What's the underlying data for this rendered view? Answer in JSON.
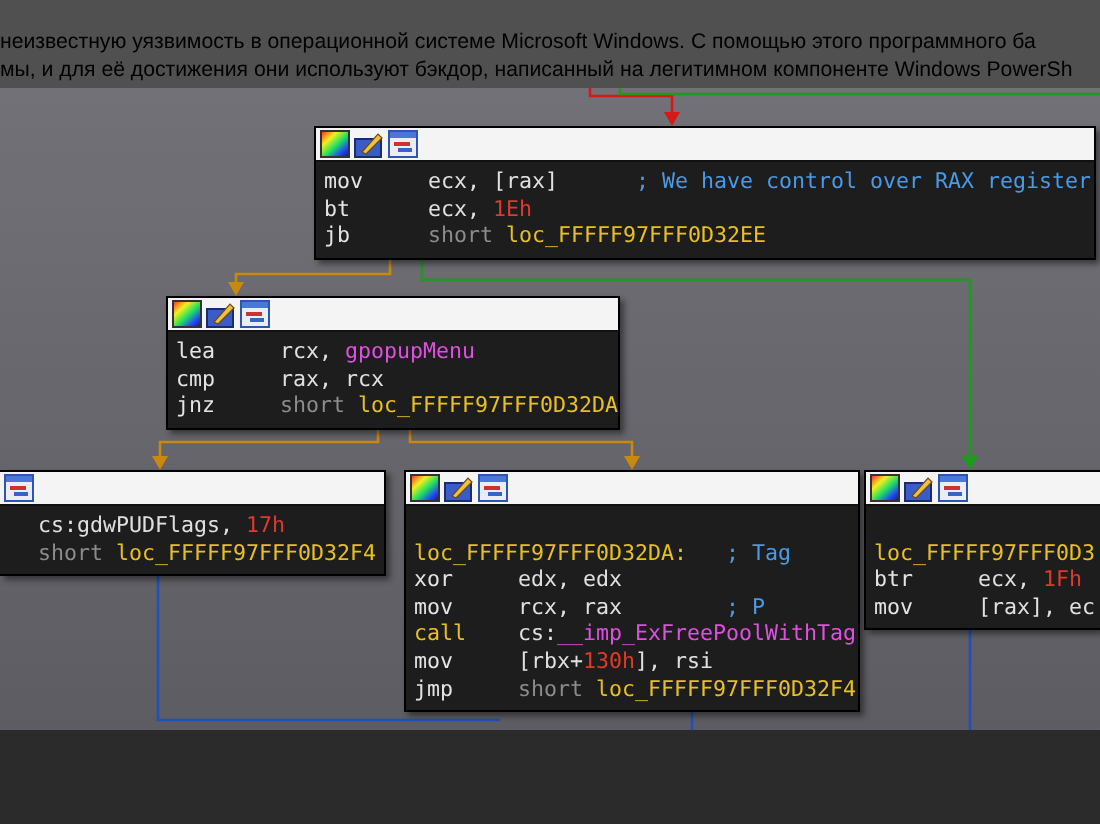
{
  "article_text": [
    "неизвестную уязвимость в операционной системе Microsoft Windows. С помощью этого программного ба",
    "мы, и для её достижения они используют бэкдор, написанный на легитимном компоненте Windows PowerSh"
  ],
  "graph": {
    "nodes": [
      {
        "lines": [
          {
            "kind": "instruction",
            "mnemonic": "mov",
            "operands": [
              {
                "text": "ecx, [rax]",
                "kind": "plain"
              }
            ],
            "comment": "; We have control over RAX register"
          },
          {
            "kind": "instruction",
            "mnemonic": "bt",
            "operands": [
              {
                "text": "ecx, ",
                "kind": "plain"
              },
              {
                "text": "1Eh",
                "kind": "number"
              }
            ]
          },
          {
            "kind": "instruction",
            "mnemonic": "jb",
            "operands": [
              {
                "text": "short ",
                "kind": "keyword"
              },
              {
                "text": "loc_FFFFF97FFF0D32EE",
                "kind": "location"
              }
            ]
          }
        ]
      },
      {
        "lines": [
          {
            "kind": "instruction",
            "mnemonic": "lea",
            "operands": [
              {
                "text": "rcx, ",
                "kind": "plain"
              },
              {
                "text": "gpopupMenu",
                "kind": "name"
              }
            ]
          },
          {
            "kind": "instruction",
            "mnemonic": "cmp",
            "operands": [
              {
                "text": "rax, rcx",
                "kind": "plain"
              }
            ]
          },
          {
            "kind": "instruction",
            "mnemonic": "jnz",
            "operands": [
              {
                "text": "short ",
                "kind": "keyword"
              },
              {
                "text": "loc_FFFFF97FFF0D32DA",
                "kind": "location"
              }
            ]
          }
        ]
      },
      {
        "lines": [
          {
            "kind": "instruction",
            "operands": [
              {
                "text": "cs:gdwPUDFlags, ",
                "kind": "plain"
              },
              {
                "text": "17h",
                "kind": "number"
              }
            ]
          },
          {
            "kind": "instruction",
            "operands": [
              {
                "text": "short ",
                "kind": "keyword"
              },
              {
                "text": "loc_FFFFF97FFF0D32F4",
                "kind": "location"
              }
            ]
          }
        ]
      },
      {
        "lines": [
          {
            "kind": "label",
            "gap_before": true,
            "label": "loc_FFFFF97FFF0D32DA:",
            "comment": "; Tag"
          },
          {
            "kind": "instruction",
            "mnemonic": "xor",
            "operands": [
              {
                "text": "edx, edx",
                "kind": "plain"
              }
            ]
          },
          {
            "kind": "instruction",
            "mnemonic": "mov",
            "operands": [
              {
                "text": "rcx, rax",
                "kind": "plain"
              }
            ],
            "comment": "; P"
          },
          {
            "kind": "call",
            "mnemonic": "call",
            "operands": [
              {
                "text": "cs:",
                "kind": "plain"
              },
              {
                "text": "__imp_ExFreePoolWithTag",
                "kind": "name"
              }
            ]
          },
          {
            "kind": "instruction",
            "mnemonic": "mov",
            "operands": [
              {
                "text": "[rbx+",
                "kind": "plain"
              },
              {
                "text": "130h",
                "kind": "number"
              },
              {
                "text": "], rsi",
                "kind": "plain"
              }
            ]
          },
          {
            "kind": "instruction",
            "mnemonic": "jmp",
            "operands": [
              {
                "text": "short ",
                "kind": "keyword"
              },
              {
                "text": "loc_FFFFF97FFF0D32F4",
                "kind": "location"
              }
            ]
          }
        ]
      },
      {
        "lines": [
          {
            "kind": "label",
            "gap_before": true,
            "label": "loc_FFFFF97FFF0D3"
          },
          {
            "kind": "instruction",
            "mnemonic": "btr",
            "operands": [
              {
                "text": "ecx, ",
                "kind": "plain"
              },
              {
                "text": "1Fh",
                "kind": "number"
              }
            ]
          },
          {
            "kind": "instruction",
            "mnemonic": "mov",
            "operands": [
              {
                "text": "[rax], ec",
                "kind": "plain"
              }
            ]
          }
        ]
      }
    ]
  }
}
